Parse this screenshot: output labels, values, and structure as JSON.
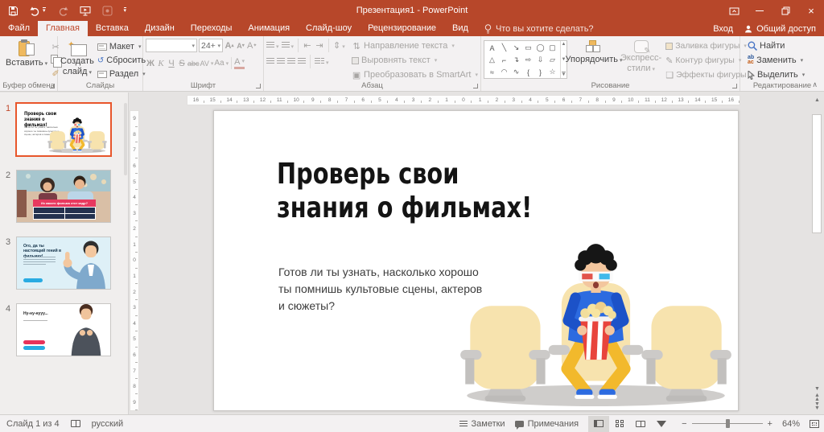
{
  "window": {
    "title": "Презентация1 - PowerPoint",
    "controls": {
      "minimize": "–",
      "close": "×"
    },
    "qat_icons": [
      "save-icon",
      "undo-icon",
      "redo-icon",
      "start-slideshow-icon",
      "touch-mode-icon",
      "customize-qat-icon"
    ]
  },
  "tabs": {
    "items": [
      "Файл",
      "Главная",
      "Вставка",
      "Дизайн",
      "Переходы",
      "Анимация",
      "Слайд-шоу",
      "Рецензирование",
      "Вид"
    ],
    "active": "Главная",
    "search_placeholder": "Что вы хотите сделать?",
    "sign_in": "Вход",
    "share": "Общий доступ"
  },
  "ribbon": {
    "clipboard": {
      "label": "Буфер обмена",
      "paste": "Вставить"
    },
    "slides": {
      "label": "Слайды",
      "new_slide": "Создать слайд",
      "layout": "Макет",
      "reset": "Сбросить",
      "section": "Раздел"
    },
    "font": {
      "label": "Шрифт",
      "size": "24+",
      "bold": "Ж",
      "italic": "К",
      "underline": "Ч",
      "strike": "S",
      "abc": "abc",
      "char_spacing": "AV",
      "change_case": "Aa",
      "font_color": "А",
      "grow": "A",
      "shrink": "A"
    },
    "paragraph": {
      "label": "Абзац",
      "text_direction": "Направление текста",
      "align_text": "Выровнять текст",
      "smartart": "Преобразовать в SmartArt"
    },
    "drawing": {
      "label": "Рисование",
      "arrange": "Упорядочить",
      "quick_styles": "Экспресс-стили",
      "shape_fill": "Заливка фигуры",
      "shape_outline": "Контур фигуры",
      "shape_effects": "Эффекты фигуры",
      "shapes": [
        "A",
        "╲",
        "↘",
        "▭",
        "◯",
        "▢",
        "△",
        "⌐",
        "↴",
        "⇨",
        "⇩",
        "▱",
        "≈",
        "◠",
        "∿",
        "{",
        "}",
        "☆"
      ]
    },
    "editing": {
      "label": "Редактирование",
      "find": "Найти",
      "replace": "Заменить",
      "select": "Выделить"
    }
  },
  "rulers": {
    "horizontal": [
      16,
      15,
      14,
      13,
      12,
      11,
      10,
      9,
      8,
      7,
      6,
      5,
      4,
      3,
      2,
      1,
      0,
      1,
      2,
      3,
      4,
      5,
      6,
      7,
      8,
      9,
      10,
      11,
      12,
      13,
      14,
      15,
      16
    ],
    "vertical": [
      9,
      8,
      7,
      6,
      5,
      4,
      3,
      2,
      1,
      0,
      1,
      2,
      3,
      4,
      5,
      6,
      7,
      8,
      9
    ]
  },
  "thumbnails": [
    {
      "number": "1",
      "title": "Проверь свои знания о фильмах!"
    },
    {
      "number": "2",
      "banner": "Из какого фильма этот кадр?"
    },
    {
      "number": "3",
      "title": "Ого, да ты настоящий гений в фильмах!"
    },
    {
      "number": "4",
      "title": "Ну-ну-нууу..."
    }
  ],
  "slide": {
    "title_lines": [
      "Проверь свои",
      "знания о фильмах!"
    ],
    "body": "Готов ли ты узнать, насколько хорошо ты помнишь культовые сцены, актеров и сюжеты?"
  },
  "statusbar": {
    "slide_counter": "Слайд 1 из 4",
    "language": "русский",
    "notes": "Заметки",
    "comments": "Примечания",
    "zoom_out": "−",
    "zoom_in": "+",
    "zoom_level": "64%"
  },
  "colors": {
    "titlebar": "#B7472A",
    "ribbon_bg": "#F3F1F2",
    "selection": "#E8562B",
    "accent_blue": "#29ABE2",
    "accent_pink": "#E8325A",
    "seat": "#F7E3AE",
    "shirt": "#2C6BE0",
    "pants": "#F2B92C",
    "popcorn_red": "#E8443C"
  }
}
